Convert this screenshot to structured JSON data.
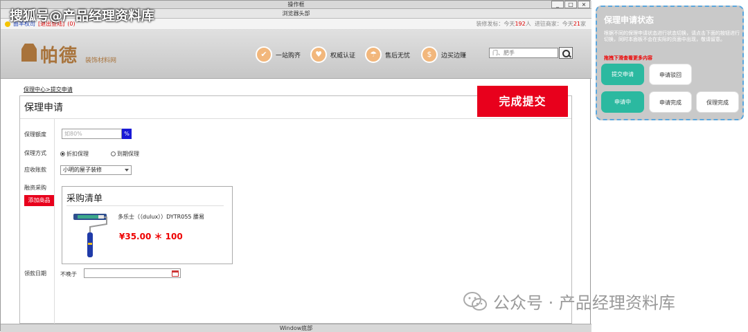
{
  "watermark_top": "搜狐号@产品经理资料库",
  "window": {
    "title": "操作框",
    "browser_header": "浏览器头部",
    "footer": "Window底部",
    "buttons": [
      "_",
      "□",
      "×"
    ]
  },
  "infobar": {
    "left_link": "由羊权司",
    "logout": "[退出登陆]",
    "count": "(0)",
    "right_label_1": "装修发标：今天",
    "right_num_1": "192",
    "right_unit_1": "人",
    "right_label_2": "进驻商家：今天",
    "right_num_2": "21",
    "right_unit_2": "家"
  },
  "header": {
    "logo_text": "帕德",
    "logo_sub": "装饰材料网",
    "features": [
      {
        "icon": "check-icon",
        "glyph": "✔",
        "label": "一站购齐"
      },
      {
        "icon": "heart-icon",
        "glyph": "♥",
        "label": "权威认证"
      },
      {
        "icon": "umbrella-icon",
        "glyph": "☂",
        "label": "售后无忧"
      },
      {
        "icon": "dollar-icon",
        "glyph": "$",
        "label": "边买边赚"
      }
    ],
    "search_placeholder": "门、肥手"
  },
  "breadcrumb": "保理中心>提交申请",
  "form": {
    "title": "保理申请",
    "labels": {
      "amount": "保理额度",
      "method": "保理方式",
      "receivable": "应收账款",
      "purchase": "融资采购",
      "date": "领款日期"
    },
    "amount_placeholder": "如80%",
    "amount_unit": "%",
    "method_options": [
      "折扣保理",
      "到期保理"
    ],
    "method_selected": "折扣保理",
    "receivable_value": "小明的屋子装修",
    "add_goods": "添加商品",
    "date_prefix": "不晚于",
    "submit": "完成提交"
  },
  "purchase_card": {
    "title": "采购清单",
    "product_name": "多乐士（（dulux））DYTR055 腰易",
    "price": "¥35.00 ＊ 100"
  },
  "side_panel": {
    "title": "保理申请状态",
    "description": "根据不同的保理申请状态进行状态切换，请点击下面的按钮进行切换，同时本面板不会在实际的页面中出现，敬请留意。",
    "note": "拖拽下滑查看更多内容",
    "buttons": [
      "提交申请",
      "申请驳回",
      "申请中",
      "申请完成",
      "保理完成"
    ]
  },
  "watermark_bottom": "公众号 · 产品经理资料库"
}
